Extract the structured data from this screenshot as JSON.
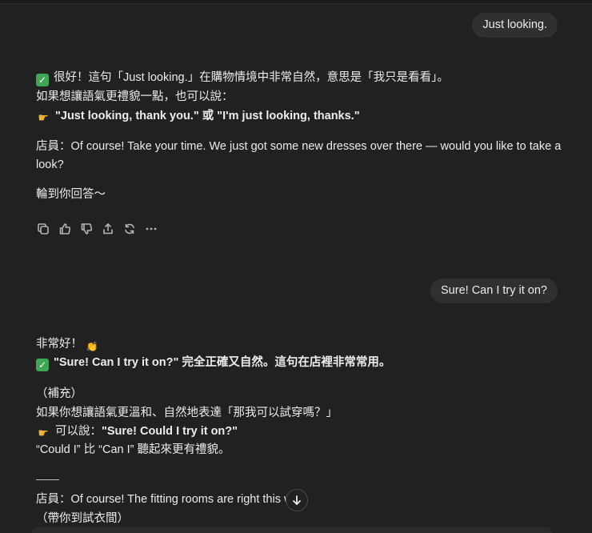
{
  "messages": {
    "user1": "Just looking.",
    "a1_line1": "很好！這句「Just looking.」在購物情境中非常自然，意思是「我只是看看」。",
    "a1_line2": "如果想讓語氣更禮貌一點，也可以說：",
    "a1_line3": "\"Just looking, thank you.\" 或 \"I'm just looking, thanks.\"",
    "a1_line4": "店員：Of course! Take your time. We just got some new dresses over there — would you like to take a",
    "a1_line5": "look?",
    "a1_line6": "輪到你回答～",
    "user2": "Sure! Can I try it on?",
    "a2_line1": "非常好！",
    "a2_line2": "\"Sure!  Can I try it on?\" 完全正確又自然。這句在店裡非常常用。",
    "a2_line3": "（補充）",
    "a2_line4": "如果你想讓語氣更溫和、自然地表達「那我可以試穿嗎？」",
    "a2_line5_prefix": "可以說：",
    "a2_line5_bold": "\"Sure!  Could I try it on?\"",
    "a2_line6": "“Could I” 比 “Can I” 聽起來更有禮貌。",
    "a2_line7": "店員：Of course! The fitting rooms are right this w",
    "a2_line8": "（帶你到試衣間）"
  },
  "icons": {
    "check": "check-mark-emoji",
    "point": "pointing-hand-emoji",
    "clap": "clapping-hands-emoji"
  },
  "actions": [
    "copy-icon",
    "thumbs-up-icon",
    "thumbs-down-icon",
    "share-icon",
    "regenerate-icon",
    "more-icon"
  ]
}
